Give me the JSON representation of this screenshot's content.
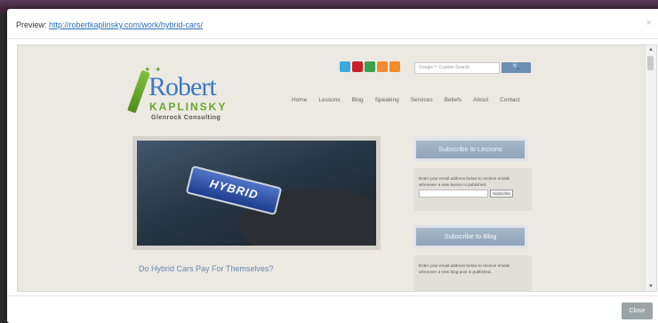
{
  "modal": {
    "preview_label": "Preview:",
    "preview_url": "http://robertkaplinsky.com/work/hybrid-cars/",
    "close_x": "×",
    "close_button": "Close"
  },
  "site": {
    "logo": {
      "sparks": "✦ ✦",
      "name_top": "Robert",
      "name_bottom": "KAPLINSKY",
      "company": "Glenrock Consulting"
    },
    "social_icons": [
      {
        "name": "twitter-icon",
        "color": "#3aa9e0"
      },
      {
        "name": "pinterest-icon",
        "color": "#cb2027"
      },
      {
        "name": "linkedin-icon",
        "color": "#3aa14a"
      },
      {
        "name": "rss-icon",
        "color": "#f28b30"
      },
      {
        "name": "rss-icon",
        "color": "#f08a2a"
      }
    ],
    "search": {
      "placeholder": "Google™ Custom Search",
      "button": "🔍"
    },
    "nav": [
      "Home",
      "Lessons",
      "Blog",
      "Speaking",
      "Services",
      "Beliefs",
      "About",
      "Contact"
    ],
    "hero_badge": "HYBRID",
    "post_title": "Do Hybrid Cars Pay For Themselves?",
    "widgets": {
      "lessons_title": "Subscribe to Lessons",
      "lessons_text": "Enter your email address below to receive emails whenever a new lesson is published.",
      "lessons_button": "Subscribe",
      "blog_title": "Subscribe to Blog",
      "blog_text": "Enter your email address below to receive emails whenever a new blog post is published."
    }
  },
  "scrollbar": {
    "up": "▲",
    "down": "▼"
  }
}
